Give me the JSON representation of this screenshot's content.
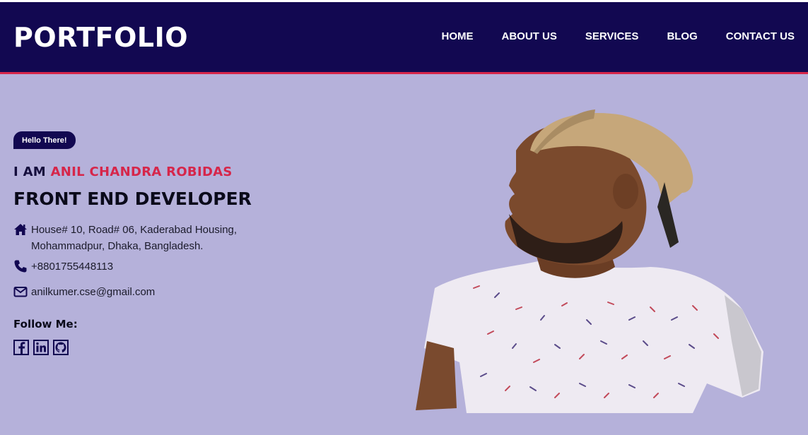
{
  "brand": "PORTFOLIO",
  "nav": [
    "HOME",
    "ABOUT US",
    "SERVICES",
    "BLOG",
    "CONTACT US"
  ],
  "hero": {
    "badge": "Hello There!",
    "intro_prefix": "I AM ",
    "name": "ANIL CHANDRA ROBIDAS",
    "role": "FRONT END DEVELOPER",
    "address_line1": "House# 10, Road# 06, Kaderabad Housing,",
    "address_line2": "Mohammadpur, Dhaka, Bangladesh.",
    "phone": "+8801755448113",
    "email": "anilkumer.cse@gmail.com",
    "follow_label": "Follow Me:",
    "socials": [
      "facebook-icon",
      "linkedin-icon",
      "github-icon"
    ]
  },
  "colors": {
    "navbar": "#120851",
    "accent": "#d6264a",
    "background": "#b5b1da"
  },
  "icons": {
    "address": "home-icon",
    "phone": "phone-icon",
    "email": "envelope-icon"
  }
}
